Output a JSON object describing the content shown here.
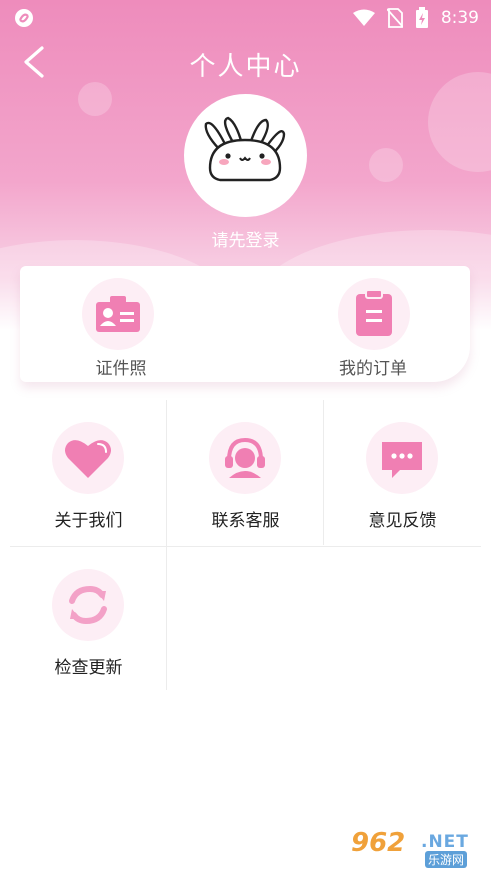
{
  "status_bar": {
    "time": "8:39",
    "icons": [
      "app-indicator-icon",
      "wifi-icon",
      "no-sim-icon",
      "battery-icon"
    ]
  },
  "header": {
    "title": "个人中心",
    "login_hint": "请先登录",
    "back_icon": "back-chevron-icon",
    "avatar_icon": "bunny-avatar-icon"
  },
  "quick_card": {
    "items": [
      {
        "label": "证件照",
        "icon": "id-card-icon"
      },
      {
        "label": "我的订单",
        "icon": "order-clipboard-icon"
      }
    ]
  },
  "menu": {
    "items": [
      {
        "label": "关于我们",
        "icon": "heart-icon"
      },
      {
        "label": "联系客服",
        "icon": "customer-service-icon"
      },
      {
        "label": "意见反馈",
        "icon": "feedback-chat-icon"
      },
      {
        "label": "检查更新",
        "icon": "refresh-icon"
      }
    ]
  },
  "watermark": {
    "number": "962",
    "suffix": ".NET",
    "subtitle": "乐游网"
  },
  "colors": {
    "header_pink": "#ee8cbc",
    "icon_pink": "#f07fb3",
    "icon_bg": "#fdeef5",
    "divider": "#ececec"
  }
}
